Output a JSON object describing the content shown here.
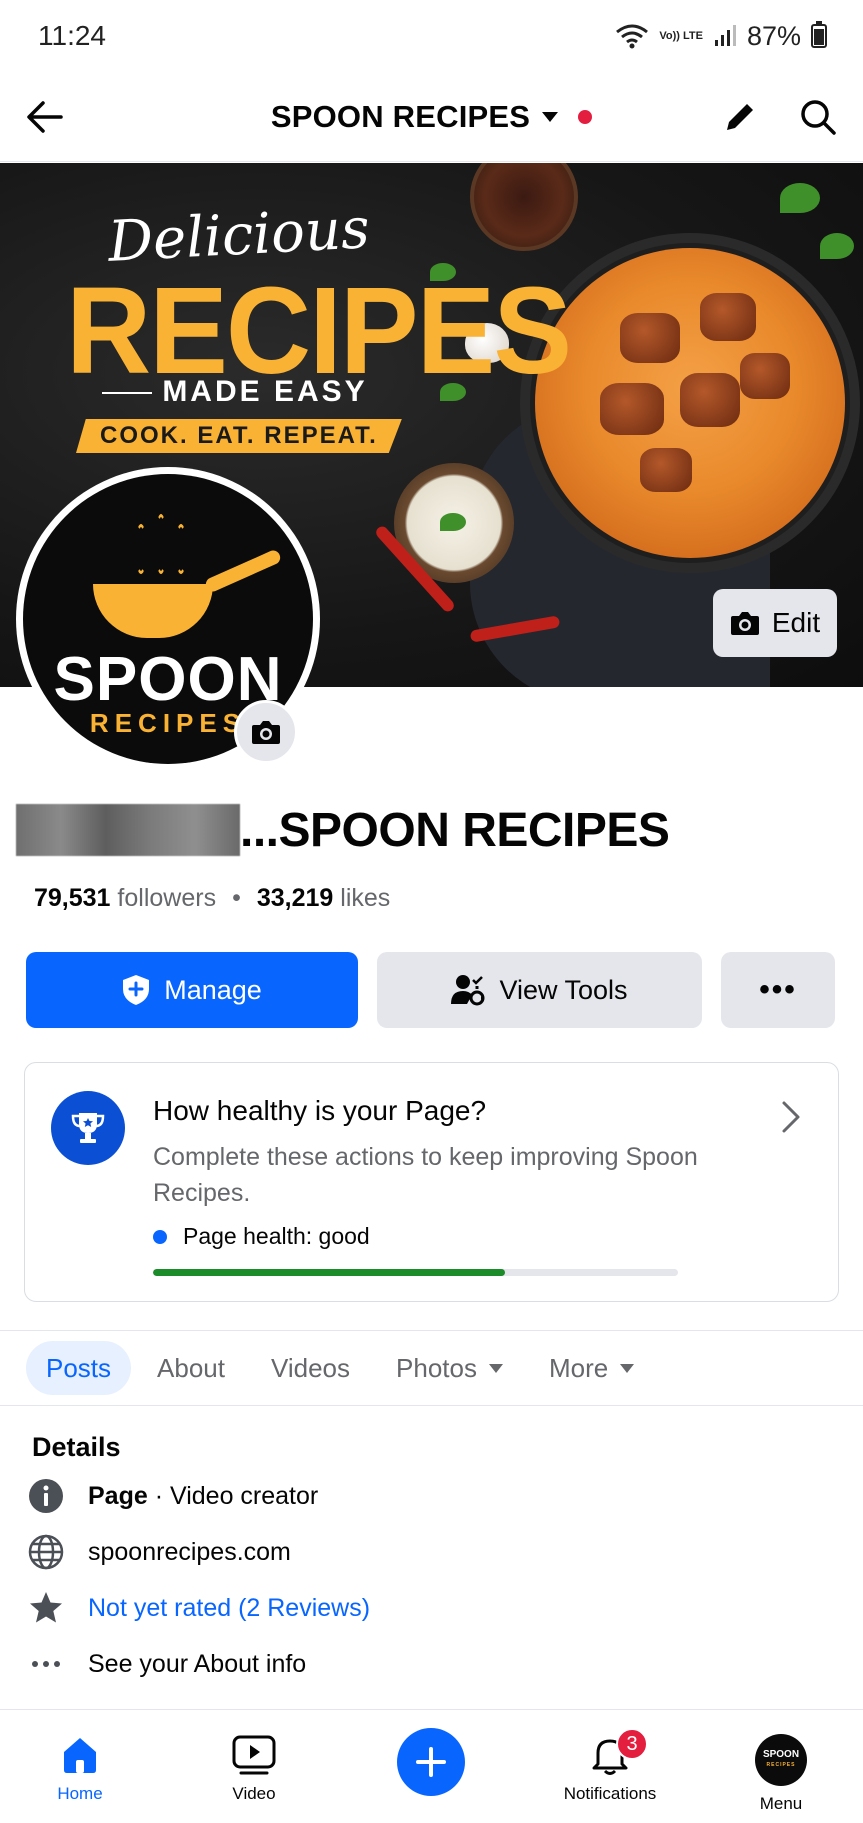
{
  "status_bar": {
    "time": "11:24",
    "network": "Vo)) LTE",
    "battery": "87%"
  },
  "header": {
    "title": "SPOON RECIPES",
    "icons": [
      "arrow-left-icon",
      "pencil-icon",
      "search-icon"
    ]
  },
  "cover": {
    "line1": "Delicious",
    "line2": "RECIPES",
    "line3": "MADE EASY",
    "tagline": "COOK. EAT. REPEAT.",
    "edit_label": "Edit"
  },
  "avatar": {
    "brand": "SPOON",
    "sub": "RECIPES"
  },
  "profile": {
    "name_suffix": "...SPOON RECIPES",
    "followers_count": "79,531",
    "followers_label": "followers",
    "likes_count": "33,219",
    "likes_label": "likes"
  },
  "actions": {
    "manage": "Manage",
    "view_tools": "View Tools",
    "more": "•••"
  },
  "page_health": {
    "title": "How healthy is your Page?",
    "subtitle": "Complete these actions to keep improving Spoon Recipes.",
    "status": "Page health: good",
    "progress_fraction": 0.67,
    "colors": {
      "progress": "#1c8c2a",
      "dot": "#0866ff"
    }
  },
  "tabs": [
    {
      "label": "Posts",
      "active": true
    },
    {
      "label": "About"
    },
    {
      "label": "Videos"
    },
    {
      "label": "Photos",
      "dropdown": true
    },
    {
      "label": "More",
      "dropdown": true
    }
  ],
  "details": {
    "title": "Details",
    "category_bold": "Page",
    "category_rest": " · Video creator",
    "website": "spoonrecipes.com",
    "rating": "Not yet rated (2 Reviews)",
    "about": "See your About info"
  },
  "bottom_nav": {
    "home": "Home",
    "video": "Video",
    "notifications": "Notifications",
    "notifications_badge": "3",
    "menu": "Menu",
    "menu_avatar_text": "SPOON",
    "menu_avatar_sub": "RECIPES"
  },
  "colors": {
    "brand_blue": "#0866ff",
    "accent_yellow": "#f9b233",
    "badge_red": "#e41e3f"
  }
}
